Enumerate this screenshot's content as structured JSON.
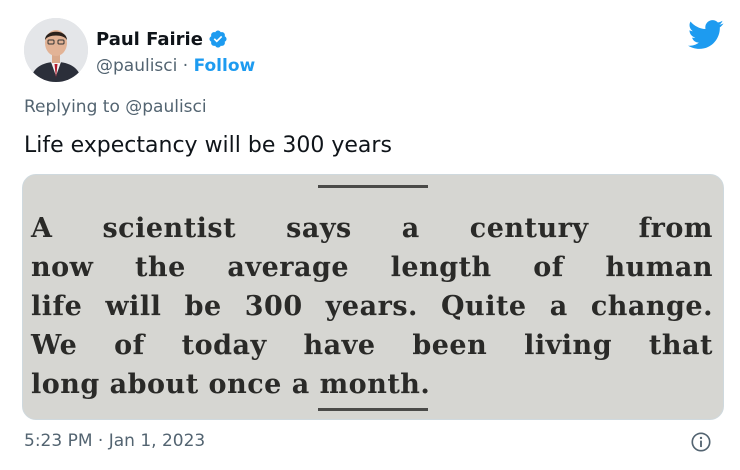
{
  "author": {
    "display_name": "Paul Fairie",
    "handle": "@paulisci",
    "separator": "·",
    "follow_label": "Follow"
  },
  "reply": {
    "prefix": "Replying to",
    "mention": "@paulisci"
  },
  "tweet": {
    "text": "Life expectancy will be 300 years"
  },
  "clipping": {
    "lines": [
      "A scientist says a century from",
      "now the average length of human",
      "life will be 300 years. Quite a change.",
      "We of today have been living that",
      "long about once a month."
    ]
  },
  "meta": {
    "time": "5:23 PM",
    "separator": "·",
    "date": "Jan 1, 2023"
  },
  "icons": {
    "verified": "verified-badge-icon",
    "brand": "twitter-bird-icon",
    "info": "info-icon"
  },
  "colors": {
    "accent": "#1d9bf0",
    "secondary_text": "#536471",
    "primary_text": "#0f1419",
    "clipping_paper": "#d6d6d2"
  }
}
